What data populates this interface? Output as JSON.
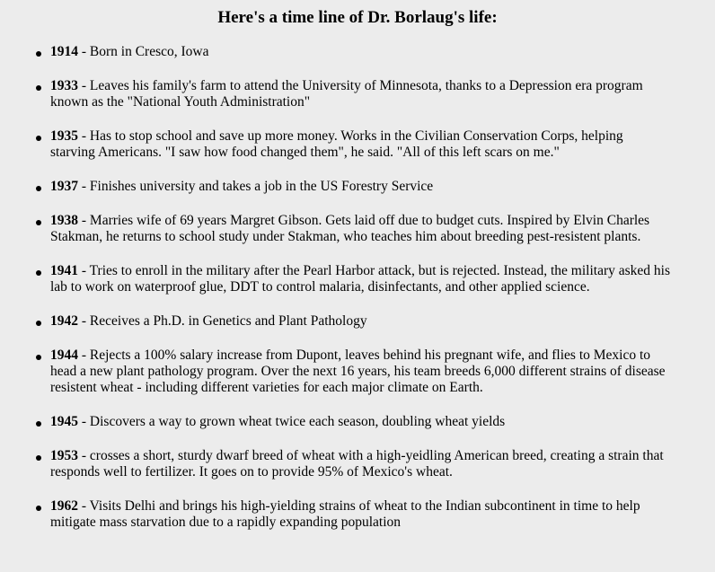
{
  "page_title": "Here's a time line of Dr. Borlaug's life:",
  "timeline": [
    {
      "year": "1914",
      "text": " - Born in Cresco, Iowa"
    },
    {
      "year": "1933",
      "text": " - Leaves his family's farm to attend the University of Minnesota, thanks to a Depression era program known as the \"National Youth Administration\""
    },
    {
      "year": "1935",
      "text": " - Has to stop school and save up more money. Works in the Civilian Conservation Corps, helping starving Americans. \"I saw how food changed them\", he said. \"All of this left scars on me.\""
    },
    {
      "year": "1937",
      "text": " - Finishes university and takes a job in the US Forestry Service"
    },
    {
      "year": "1938",
      "text": " - Marries wife of 69 years Margret Gibson. Gets laid off due to budget cuts. Inspired by Elvin Charles Stakman, he returns to school study under Stakman, who teaches him about breeding pest-resistent plants."
    },
    {
      "year": "1941",
      "text": " - Tries to enroll in the military after the Pearl Harbor attack, but is rejected. Instead, the military asked his lab to work on waterproof glue, DDT to control malaria, disinfectants, and other applied science."
    },
    {
      "year": "1942",
      "text": " - Receives a Ph.D. in Genetics and Plant Pathology"
    },
    {
      "year": "1944",
      "text": " - Rejects a 100% salary increase from Dupont, leaves behind his pregnant wife, and flies to Mexico to head a new plant pathology program. Over the next 16 years, his team breeds 6,000 different strains of disease resistent wheat - including different varieties for each major climate on Earth."
    },
    {
      "year": "1945",
      "text": " - Discovers a way to grown wheat twice each season, doubling wheat yields"
    },
    {
      "year": "1953",
      "text": " - crosses a short, sturdy dwarf breed of wheat with a high-yeidling American breed, creating a strain that responds well to fertilizer. It goes on to provide 95% of Mexico's wheat."
    },
    {
      "year": "1962",
      "text": " - Visits Delhi and brings his high-yielding strains of wheat to the Indian subcontinent in time to help mitigate mass starvation due to a rapidly expanding population"
    }
  ]
}
